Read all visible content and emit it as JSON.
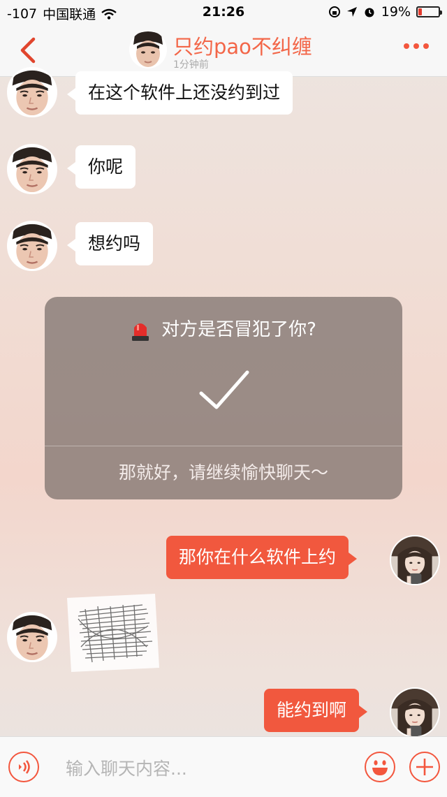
{
  "status_bar": {
    "signal": "-107",
    "carrier": "中国联通",
    "time": "21:26",
    "battery": "19%",
    "battery_level": 0.19,
    "icons": [
      "wifi-icon",
      "orientation-lock-icon",
      "location-arrow-icon",
      "alarm-icon",
      "battery-icon"
    ]
  },
  "nav": {
    "title": "只约pao不纠缠",
    "subtitle": "1分钟前"
  },
  "messages": [
    {
      "side": "in",
      "text": "在这个软件上还没约到过"
    },
    {
      "side": "in",
      "text": "你呢"
    },
    {
      "side": "in",
      "text": "想约吗"
    },
    {
      "side": "out",
      "text": "那你在什么软件上约"
    },
    {
      "side": "in",
      "text": ""
    },
    {
      "side": "out",
      "text": "能约到啊"
    }
  ],
  "report_dialog": {
    "question": "对方是否冒犯了你?",
    "reply": "那就好，请继续愉快聊天～",
    "icon": "alarm-light-icon"
  },
  "input": {
    "placeholder": "输入聊天内容..."
  },
  "colors": {
    "accent": "#f3563d",
    "title": "#f36648",
    "outgoing_bubble": "#f1583e"
  }
}
